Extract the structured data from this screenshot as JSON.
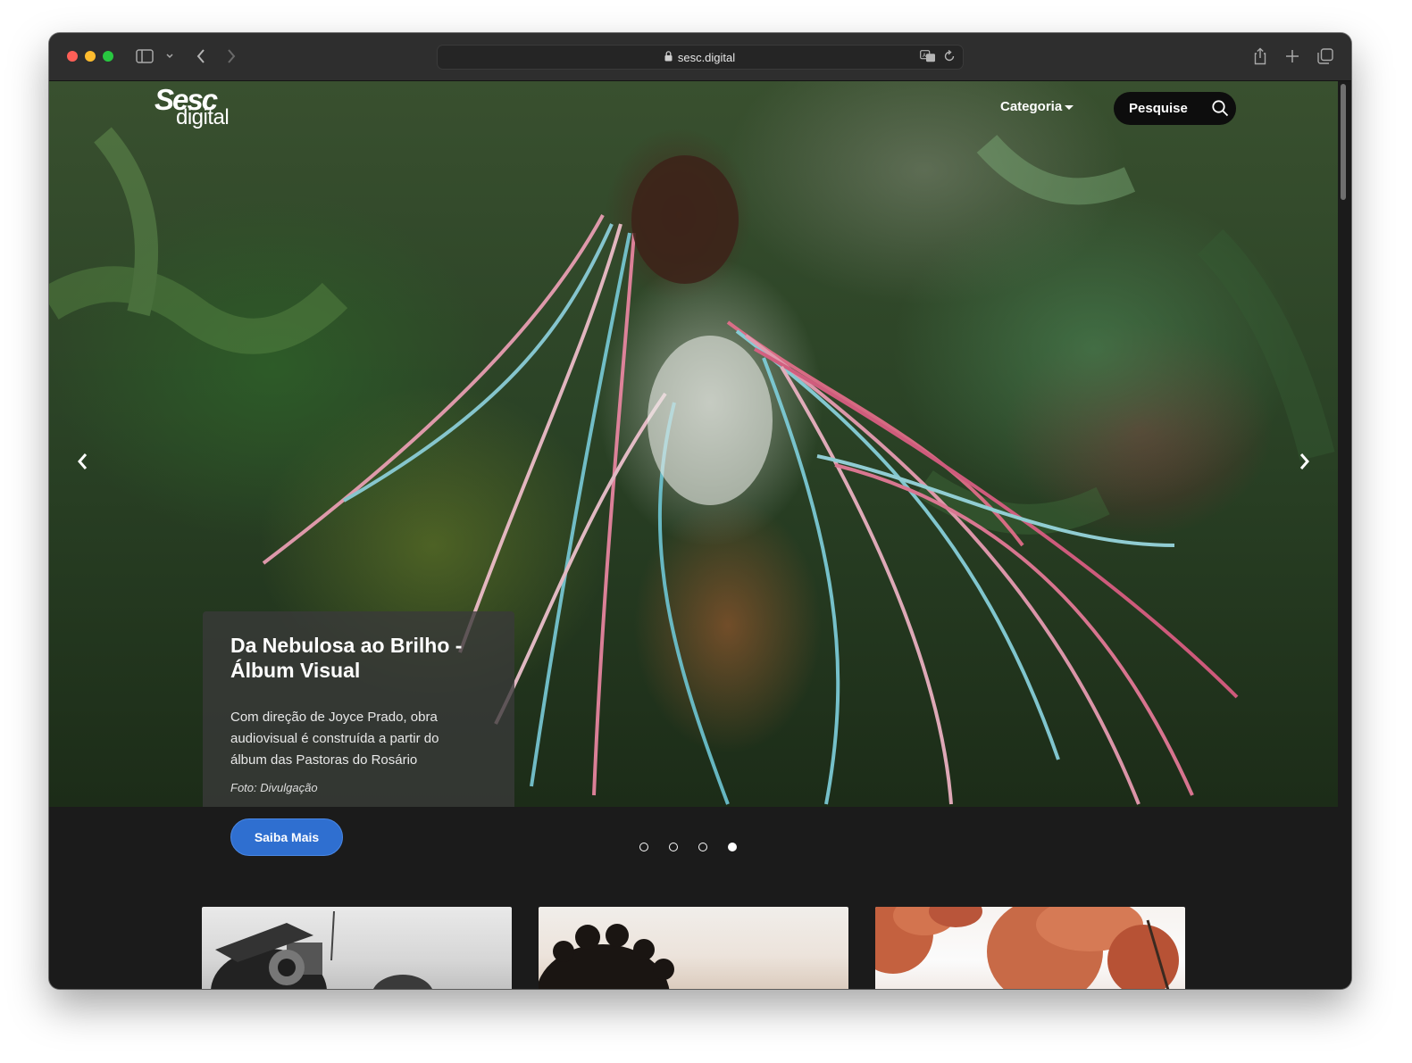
{
  "browser": {
    "url": "sesc.digital",
    "icons": {
      "sidebar": "sidebar-icon",
      "tab_overview_toggle": "chevron-down-icon",
      "back": "chevron-left-icon",
      "forward": "chevron-right-icon",
      "lock": "lock-icon",
      "translate": "translate-icon",
      "reload": "reload-icon",
      "share": "share-icon",
      "new_tab": "plus-icon",
      "tabs": "tabs-icon"
    }
  },
  "site": {
    "logo": {
      "line1": "Sesc",
      "line2": "digital"
    },
    "nav": {
      "category_label": "Categoria",
      "search_label": "Pesquise"
    }
  },
  "hero": {
    "title": "Da Nebulosa ao Brilho - Álbum Visual",
    "description": "Com direção de Joyce Prado, obra audiovisual é construída a partir do álbum das Pastoras do Rosário",
    "credit": "Foto: Divulgação",
    "cta_label": "Saiba Mais",
    "slides_total": 4,
    "active_slide": 4
  },
  "cards": [
    {
      "name": "card-1"
    },
    {
      "name": "card-2"
    },
    {
      "name": "card-3"
    }
  ],
  "colors": {
    "background": "#1b1b1b",
    "accent": "#2f6fd0",
    "titlebar": "#2e2e2e"
  }
}
